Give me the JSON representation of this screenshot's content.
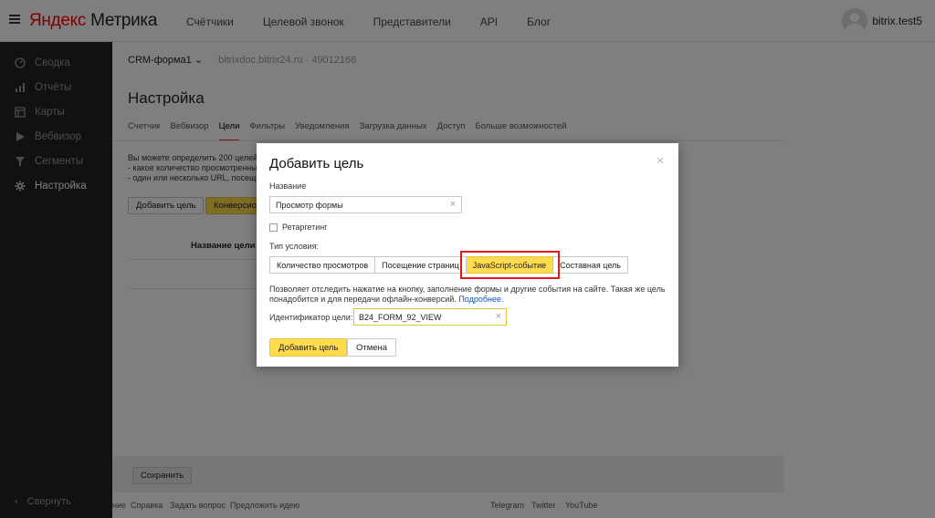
{
  "header": {
    "logo_part1": "Яндекс",
    "logo_part2": "Метрика",
    "nav": [
      "Счётчики",
      "Целевой звонок",
      "Представители",
      "API",
      "Блог"
    ],
    "username": "bitrix.test5"
  },
  "sidebar": {
    "items": [
      {
        "label": "Сводка",
        "icon": "dashboard-icon"
      },
      {
        "label": "Отчёты",
        "icon": "bar-chart-icon"
      },
      {
        "label": "Карты",
        "icon": "map-icon"
      },
      {
        "label": "Вебвизор",
        "icon": "play-icon"
      },
      {
        "label": "Сегменты",
        "icon": "filter-icon"
      },
      {
        "label": "Настройка",
        "icon": "gear-icon"
      }
    ],
    "active_index": 5,
    "collapse_label": "Свернуть"
  },
  "main": {
    "counter_name": "CRM-форма1",
    "counter_site": "bitrixdoc.bitrix24.ru · 49012166",
    "page_title": "Настройка",
    "tabs": [
      "Счетчик",
      "Вебвизор",
      "Цели",
      "Фильтры",
      "Уведомления",
      "Загрузка данных",
      "Доступ",
      "Больше возможностей"
    ],
    "active_tab": 2,
    "intro_lines": [
      "Вы можете определить 200 целей д",
      "- какое количество просмотренны",
      "- один или несколько URL, посеще"
    ],
    "add_goal_label": "Добавить цель",
    "conversion_label": "Конверсион",
    "column_header": "Название цели",
    "save_label": "Сохранить",
    "footer_links": [
      "ние",
      "Справка",
      "Задать вопрос",
      "Предложить идею"
    ],
    "footer_social": [
      "Telegram",
      "Twitter",
      "YouTube"
    ]
  },
  "modal": {
    "title": "Добавить цель",
    "name_label": "Название",
    "name_value": "Просмотр формы",
    "retargeting_label": "Ретаргетинг",
    "retargeting_checked": false,
    "condition_label": "Тип условия:",
    "condition_types": [
      "Количество просмотров",
      "Посещение страниц",
      "JavaScript-событие",
      "Составная цель"
    ],
    "active_condition": 2,
    "help_text_1": "Позволяет отследить нажатие на кнопку, заполнение формы и другие события на сайте. Такая же цель",
    "help_text_2": "понадобится и для передачи офлайн-конверсий.",
    "help_link": "Подробнее.",
    "id_label": "Идентификатор цели:",
    "id_value": "B24_FORM_92_VIEW",
    "add_button": "Добавить цель",
    "cancel_button": "Отмена"
  },
  "colors": {
    "accent_yellow": "#ffdb4d",
    "highlight_red": "#e0181a",
    "sidebar_bg": "#222222",
    "link_blue": "#0b55c0"
  }
}
